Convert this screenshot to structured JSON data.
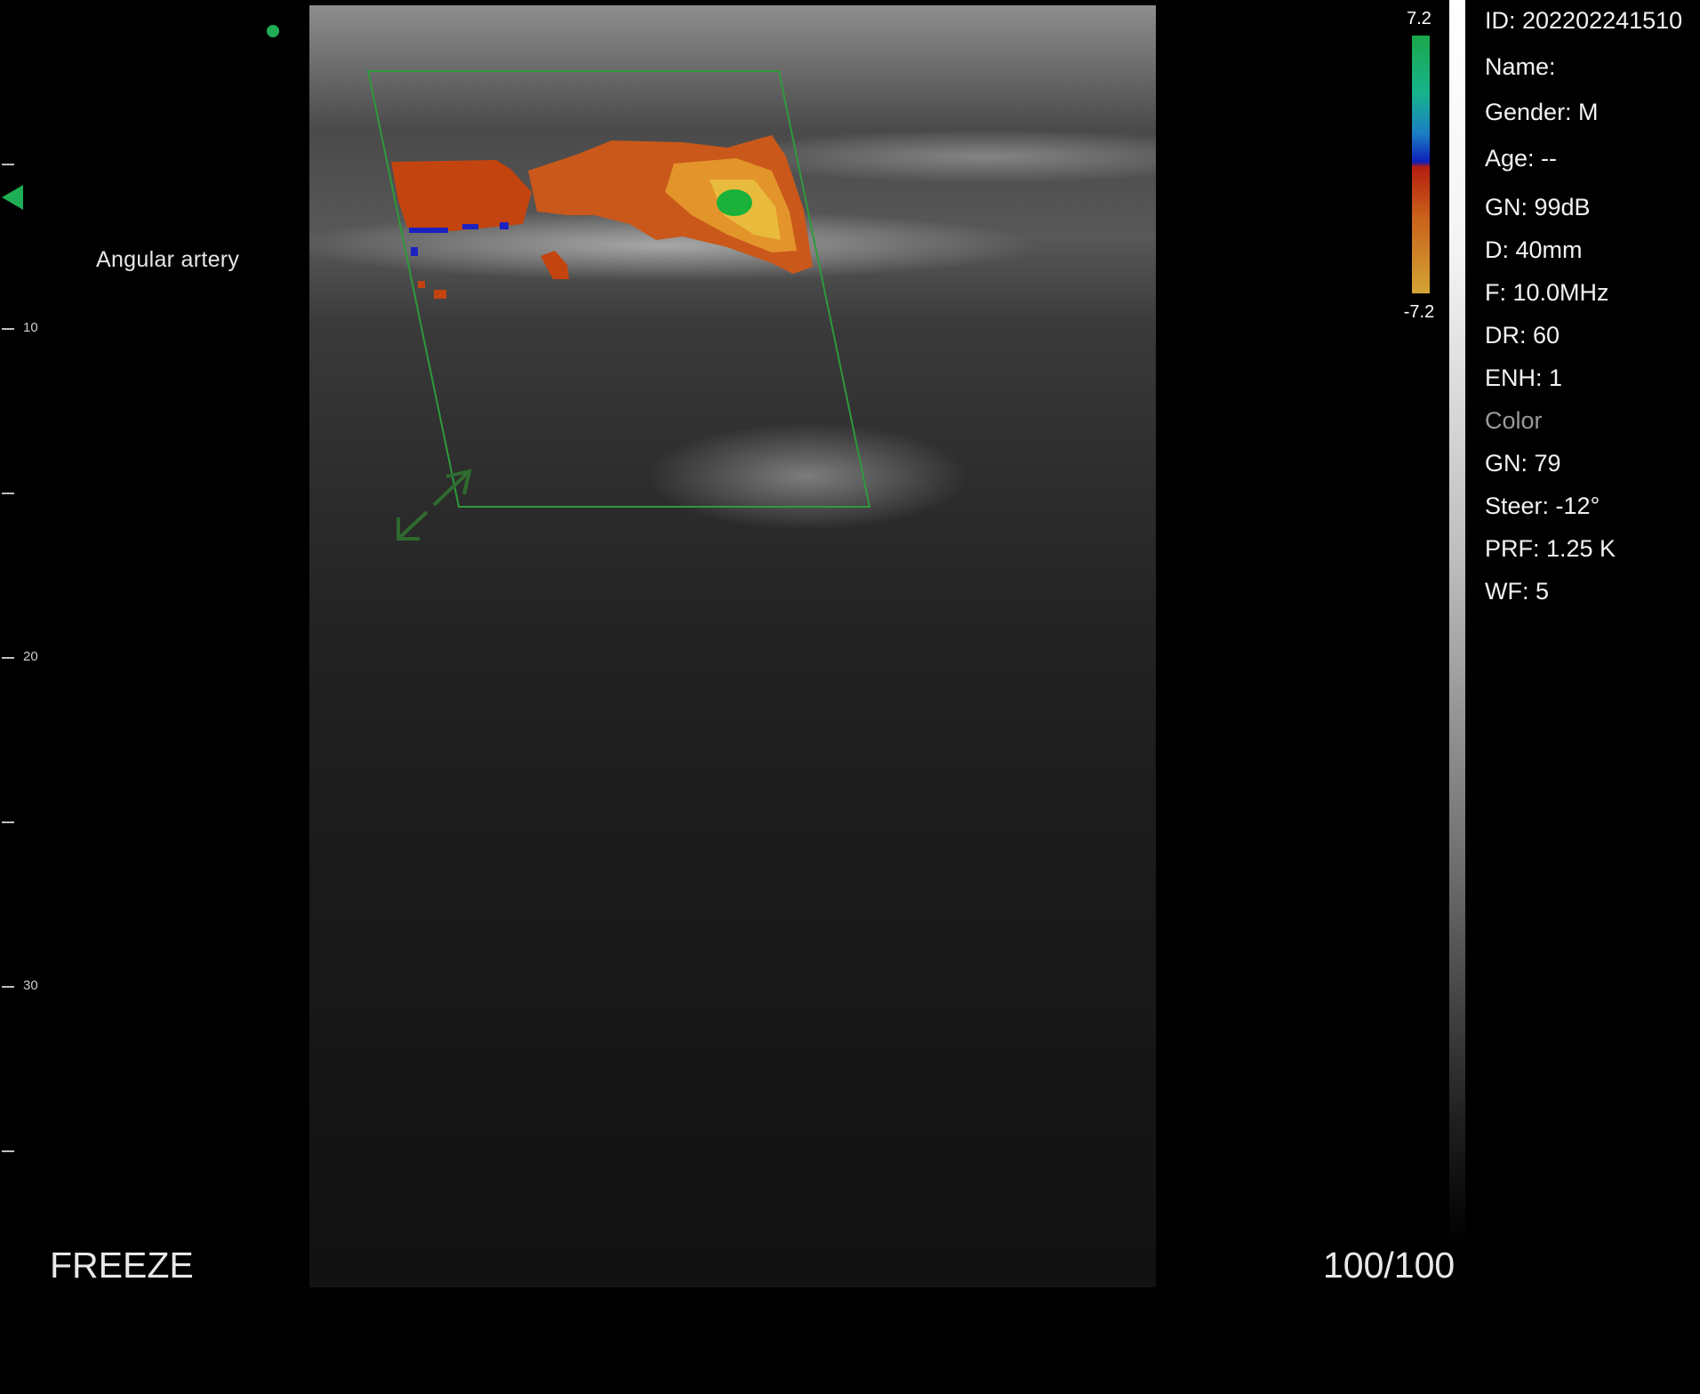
{
  "annotation": "Angular artery",
  "status": {
    "freeze_label": "FREEZE",
    "frame_counter": "100/100"
  },
  "depth_ruler": {
    "labels": [
      "10",
      "20",
      "30"
    ]
  },
  "color_scale": {
    "max": "7.2",
    "min": "-7.2"
  },
  "info": {
    "id": "ID: 202202241510",
    "name": "Name:",
    "gender": "Gender: M",
    "age": "Age: --",
    "bmode_gain": "GN: 99dB",
    "depth": "D: 40mm",
    "frequency": "F: 10.0MHz",
    "dynamic_range": "DR: 60",
    "enhancement": "ENH: 1",
    "color_section": "Color",
    "color_gain": "GN: 79",
    "steer": "Steer: -12°",
    "prf": "PRF: 1.25 K",
    "wall_filter": "WF: 5"
  },
  "colors": {
    "roi_box": "#2e9a3a",
    "orientation_marker": "#1fae55",
    "flow_red": "#c4440f",
    "flow_orange": "#e07a1c",
    "flow_yellow": "#e9bb3c",
    "flow_green": "#1bb13a",
    "flow_blue": "#1b22c0"
  },
  "icons": {
    "resize_roi": "resize-arrows-icon"
  }
}
